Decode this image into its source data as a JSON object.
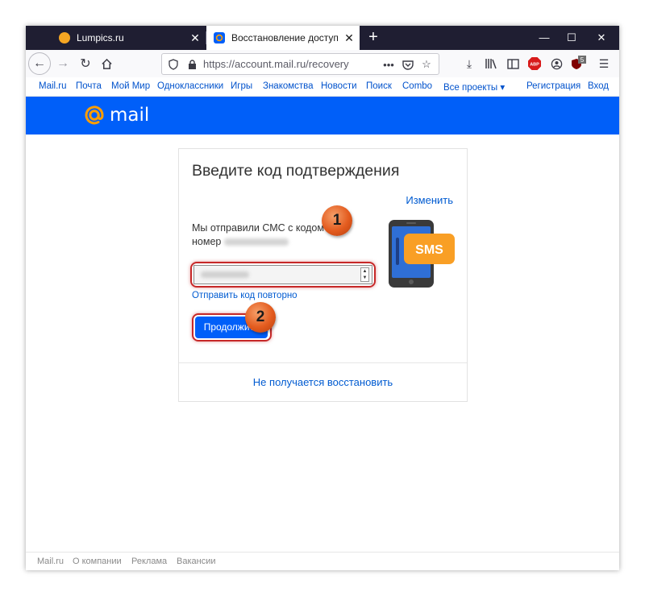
{
  "browser": {
    "tabs": [
      {
        "title": "Lumpics.ru",
        "active": false,
        "favicon_color": "#f5a623"
      },
      {
        "title": "Восстановление доступа",
        "active": true,
        "favicon_color": "#005ff9"
      }
    ],
    "url": "https://account.mail.ru/recovery",
    "badge_count": "5"
  },
  "portal_nav": {
    "items": [
      "Mail.ru",
      "Почта",
      "Мой Мир",
      "Одноклассники",
      "Игры",
      "Знакомства",
      "Новости",
      "Поиск",
      "Combo",
      "Все проекты ▾"
    ],
    "register": "Регистрация",
    "login": "Вход"
  },
  "brand": {
    "logo_text": "mail",
    "bar_color": "#005ff9",
    "at_color": "#ff9e00"
  },
  "card": {
    "title": "Введите код подтверждения",
    "change_link": "Изменить",
    "sent_text_line1": "Мы отправили СМС с кодом на",
    "sent_text_line2": "номер",
    "resend_link": "Отправить код повторно",
    "continue_button": "Продолжить",
    "cant_restore_link": "Не получается восстановить",
    "sms_label": "SMS"
  },
  "annotations": {
    "marker1": "1",
    "marker2": "2",
    "highlight_color": "#c62828"
  },
  "footer": {
    "items": [
      "Mail.ru",
      "О компании",
      "Реклама",
      "Вакансии"
    ]
  }
}
